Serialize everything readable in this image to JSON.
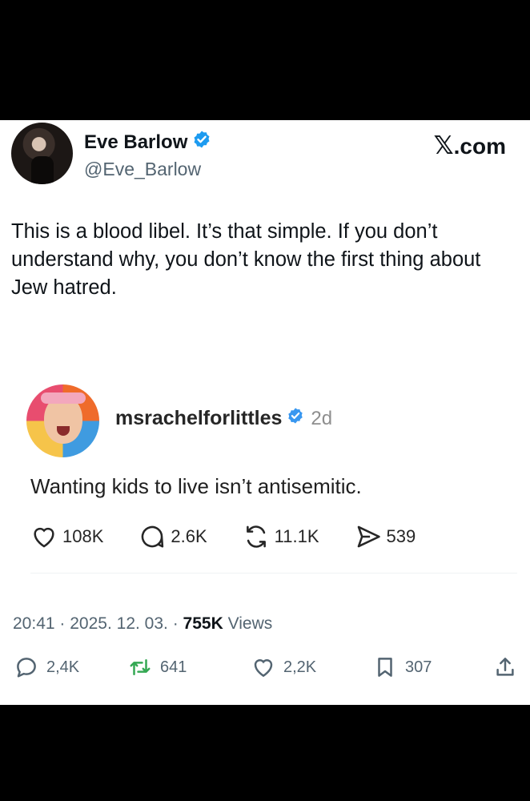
{
  "author": {
    "display_name": "Eve Barlow",
    "handle": "@Eve_Barlow",
    "verified": true
  },
  "brand": {
    "x_mark": "𝕏",
    "domain": ".com"
  },
  "tweet": {
    "text": "This is a blood libel. It’s that simple. If you don’t understand why, you don’t know the first thing about Jew hatred."
  },
  "embedded_post": {
    "username": "msrachelforlittles",
    "verified": true,
    "time": "2d",
    "text": "Wanting kids to live isn’t antisemitic.",
    "stats": {
      "likes": "108K",
      "comments": "2.6K",
      "reposts": "11.1K",
      "shares": "539"
    }
  },
  "meta": {
    "time": "20:41",
    "date": "2025. 12. 03.",
    "sep": "·",
    "views_count": "755K",
    "views_label": "Views"
  },
  "actions": {
    "replies": "2,4K",
    "reposts": "641",
    "likes": "2,2K",
    "bookmarks": "307"
  },
  "colors": {
    "verified": "#1d9bf0",
    "text_primary": "#0f1419",
    "text_secondary": "#536471"
  }
}
